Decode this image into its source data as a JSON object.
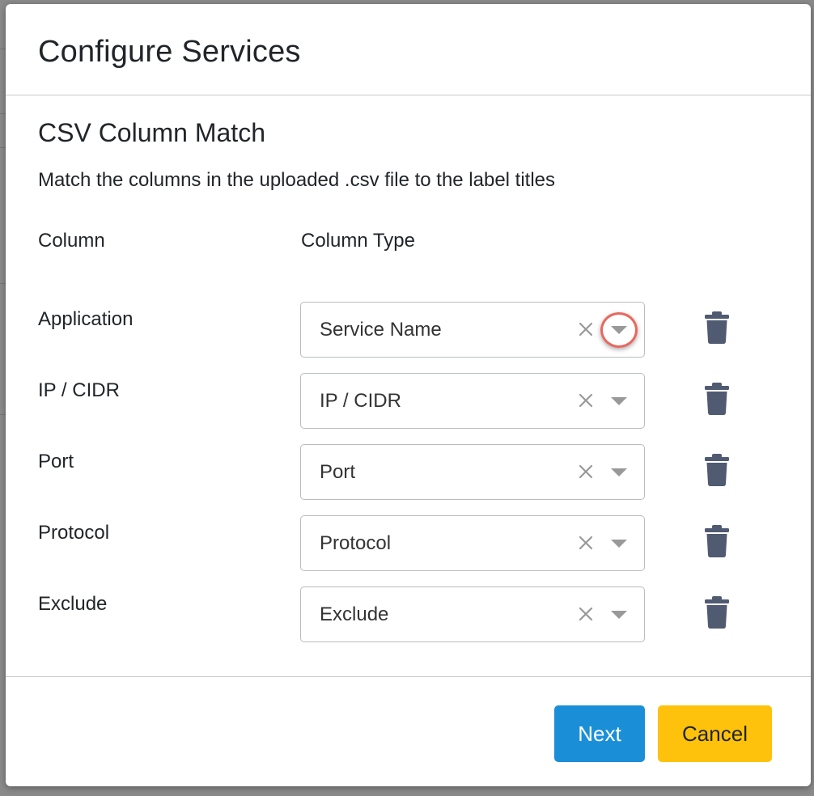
{
  "modal": {
    "title": "Configure Services"
  },
  "section": {
    "title": "CSV Column Match",
    "description": "Match the columns in the uploaded .csv file to the label titles"
  },
  "columns": {
    "column_header": "Column",
    "type_header": "Column Type"
  },
  "rows": [
    {
      "column": "Application",
      "type": "Service Name"
    },
    {
      "column": "IP / CIDR",
      "type": "IP / CIDR"
    },
    {
      "column": "Port",
      "type": "Port"
    },
    {
      "column": "Protocol",
      "type": "Protocol"
    },
    {
      "column": "Exclude",
      "type": "Exclude"
    }
  ],
  "footer": {
    "next_label": "Next",
    "cancel_label": "Cancel"
  },
  "icons": {
    "clear": "close-icon",
    "dropdown": "chevron-down-icon",
    "delete": "trash-icon"
  },
  "colors": {
    "primary": "#1a8fd8",
    "warning": "#fec20c",
    "trash": "#505a71",
    "highlight": "#e8685f"
  }
}
